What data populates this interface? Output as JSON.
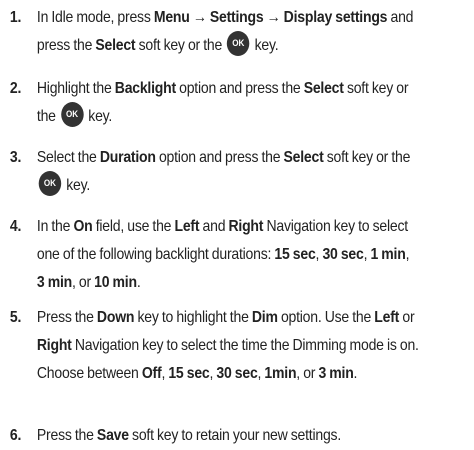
{
  "steps": [
    {
      "number": "1.",
      "parts": [
        {
          "t": "In Idle mode, press "
        },
        {
          "b": "Menu → Settings → Display settings"
        },
        {
          "t": " and press the "
        },
        {
          "b": "Select"
        },
        {
          "t": " soft key or the "
        },
        {
          "icon": "OK"
        },
        {
          "t": " key."
        }
      ]
    },
    {
      "number": "2.",
      "parts": [
        {
          "t": "Highlight the "
        },
        {
          "b": "Backlight"
        },
        {
          "t": " option and press the "
        },
        {
          "b": "Select"
        },
        {
          "t": " soft key or the "
        },
        {
          "icon": "OK"
        },
        {
          "t": " key."
        }
      ]
    },
    {
      "number": "3.",
      "parts": [
        {
          "t": "Select the "
        },
        {
          "b": "Duration"
        },
        {
          "t": " option and press the "
        },
        {
          "b": "Select"
        },
        {
          "t": " soft key or the "
        },
        {
          "icon": "OK"
        },
        {
          "t": " key."
        }
      ]
    },
    {
      "number": "4.",
      "parts": [
        {
          "t": "In the "
        },
        {
          "b": "On"
        },
        {
          "t": " field, use the "
        },
        {
          "b": "Left"
        },
        {
          "t": " and "
        },
        {
          "b": "Right"
        },
        {
          "t": " Navigation key to select one of the following backlight durations: "
        },
        {
          "b": "15 sec"
        },
        {
          "t": ", "
        },
        {
          "b": "30 sec"
        },
        {
          "t": ", "
        },
        {
          "b": "1 min"
        },
        {
          "t": ", "
        },
        {
          "b": "3 min"
        },
        {
          "t": ", or "
        },
        {
          "b": "10 min"
        },
        {
          "t": "."
        }
      ]
    },
    {
      "number": "5.",
      "parts": [
        {
          "t": "Press the "
        },
        {
          "b": "Down"
        },
        {
          "t": " key to highlight the "
        },
        {
          "b": "Dim"
        },
        {
          "t": " option. Use the "
        },
        {
          "b": "Left"
        },
        {
          "t": " or "
        },
        {
          "b": "Right"
        },
        {
          "t": " Navigation key to select the time the Dimming mode is on. Choose between "
        },
        {
          "b": "Off"
        },
        {
          "t": ", "
        },
        {
          "b": "15 sec"
        },
        {
          "t": ", "
        },
        {
          "b": "30 sec"
        },
        {
          "t": ", "
        },
        {
          "b": "1min"
        },
        {
          "t": ", or "
        },
        {
          "b": "3 min"
        },
        {
          "t": "."
        }
      ]
    },
    {
      "number": "6.",
      "parts": [
        {
          "t": "Press the "
        },
        {
          "b": "Save"
        },
        {
          "t": " soft key to retain your new settings."
        }
      ]
    }
  ]
}
